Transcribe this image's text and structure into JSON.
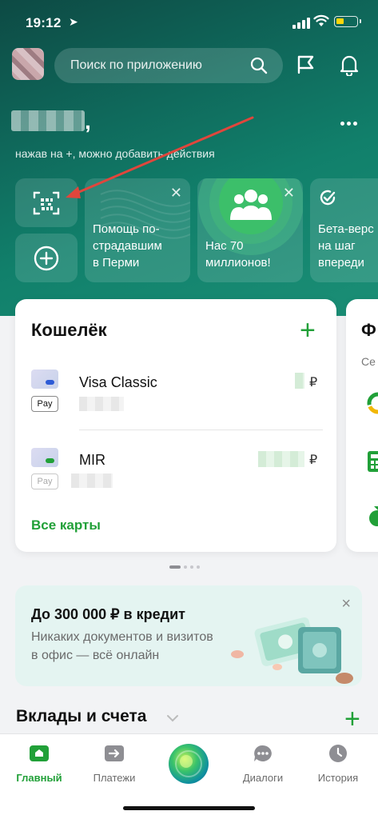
{
  "status_bar": {
    "time": "19:12",
    "location_glyph": "➤"
  },
  "header": {
    "search_placeholder": "Поиск по приложению"
  },
  "greeting": {
    "comma": ",",
    "hint": "нажав на +, можно добавить действия"
  },
  "stories": [
    {
      "text_line1": "Помощь по-",
      "text_line2": "страдавшим",
      "text_line3": "в Перми"
    },
    {
      "text_line1": "Нас 70",
      "text_line2": "миллионов!"
    },
    {
      "text_line1": "Бета-верс",
      "text_line2": "на шаг",
      "text_line3": "впереди"
    }
  ],
  "wallet": {
    "title": "Кошелёк",
    "add_glyph": "+",
    "cards": [
      {
        "name": "Visa Classic",
        "currency": "₽",
        "pay_badge": "Pay",
        "chip_color": "#2d5bd6"
      },
      {
        "name": "MIR",
        "currency": "₽",
        "pay_badge": "Pay",
        "chip_color": "#21a038"
      }
    ],
    "all_cards": "Все карты"
  },
  "next_card": {
    "title": "Ф",
    "subtitle": "Се"
  },
  "promo": {
    "title": "До 300 000 ₽ в кредит",
    "subtitle": "Никаких документов и визитов в офис — всё онлайн",
    "close": "×"
  },
  "deposits": {
    "title": "Вклады и счета",
    "add_glyph": "+"
  },
  "tabs": [
    {
      "label": "Главный"
    },
    {
      "label": "Платежи"
    },
    {
      "label": "Диалоги"
    },
    {
      "label": "История"
    }
  ],
  "colors": {
    "accent": "#21a038",
    "hero": "#0f6a5c",
    "annotation_arrow": "#e0463c"
  }
}
